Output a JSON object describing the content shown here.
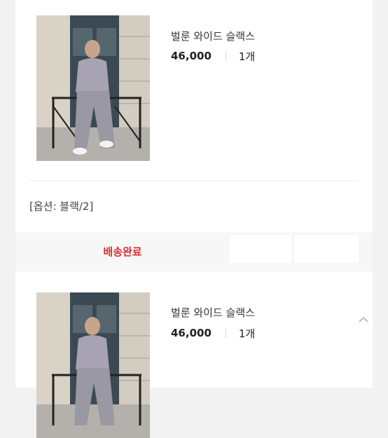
{
  "orders": [
    {
      "product_name": "벌룬 와이드 슬랙스",
      "price": "46,000",
      "quantity": "1개",
      "option": "[옵션: 블랙/2]",
      "thumbnail_icon": "product-photo"
    },
    {
      "product_name": "벌룬 와이드 슬랙스",
      "price": "46,000",
      "quantity": "1개",
      "thumbnail_icon": "product-photo"
    }
  ],
  "status": {
    "label": "배송완료",
    "color": "#d8302f"
  },
  "scroll_icon": "chevron-up-icon"
}
